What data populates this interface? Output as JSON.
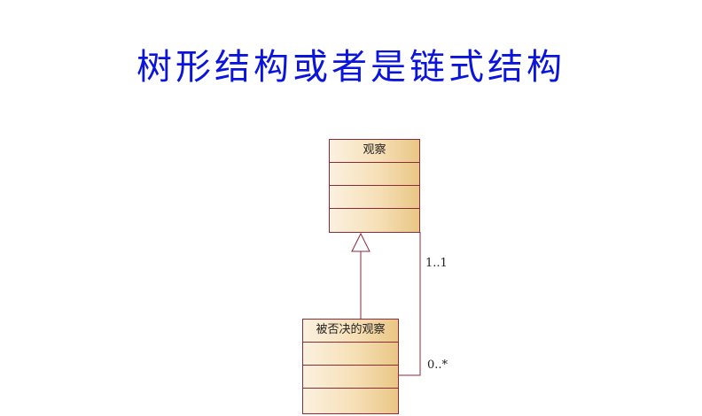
{
  "title": "树形结构或者是链式结构",
  "diagram": {
    "classes": {
      "parent": {
        "name": "观察"
      },
      "child": {
        "name": "被否决的观察"
      }
    },
    "generalization": {
      "from": "被否决的观察",
      "to": "观察"
    },
    "association": {
      "end_parent_multiplicity": "1..1",
      "end_child_multiplicity": "0..*"
    }
  },
  "colors": {
    "title": "#0a14dc",
    "class_border": "#8b2a3a",
    "class_fill": "#f6dfb6"
  }
}
